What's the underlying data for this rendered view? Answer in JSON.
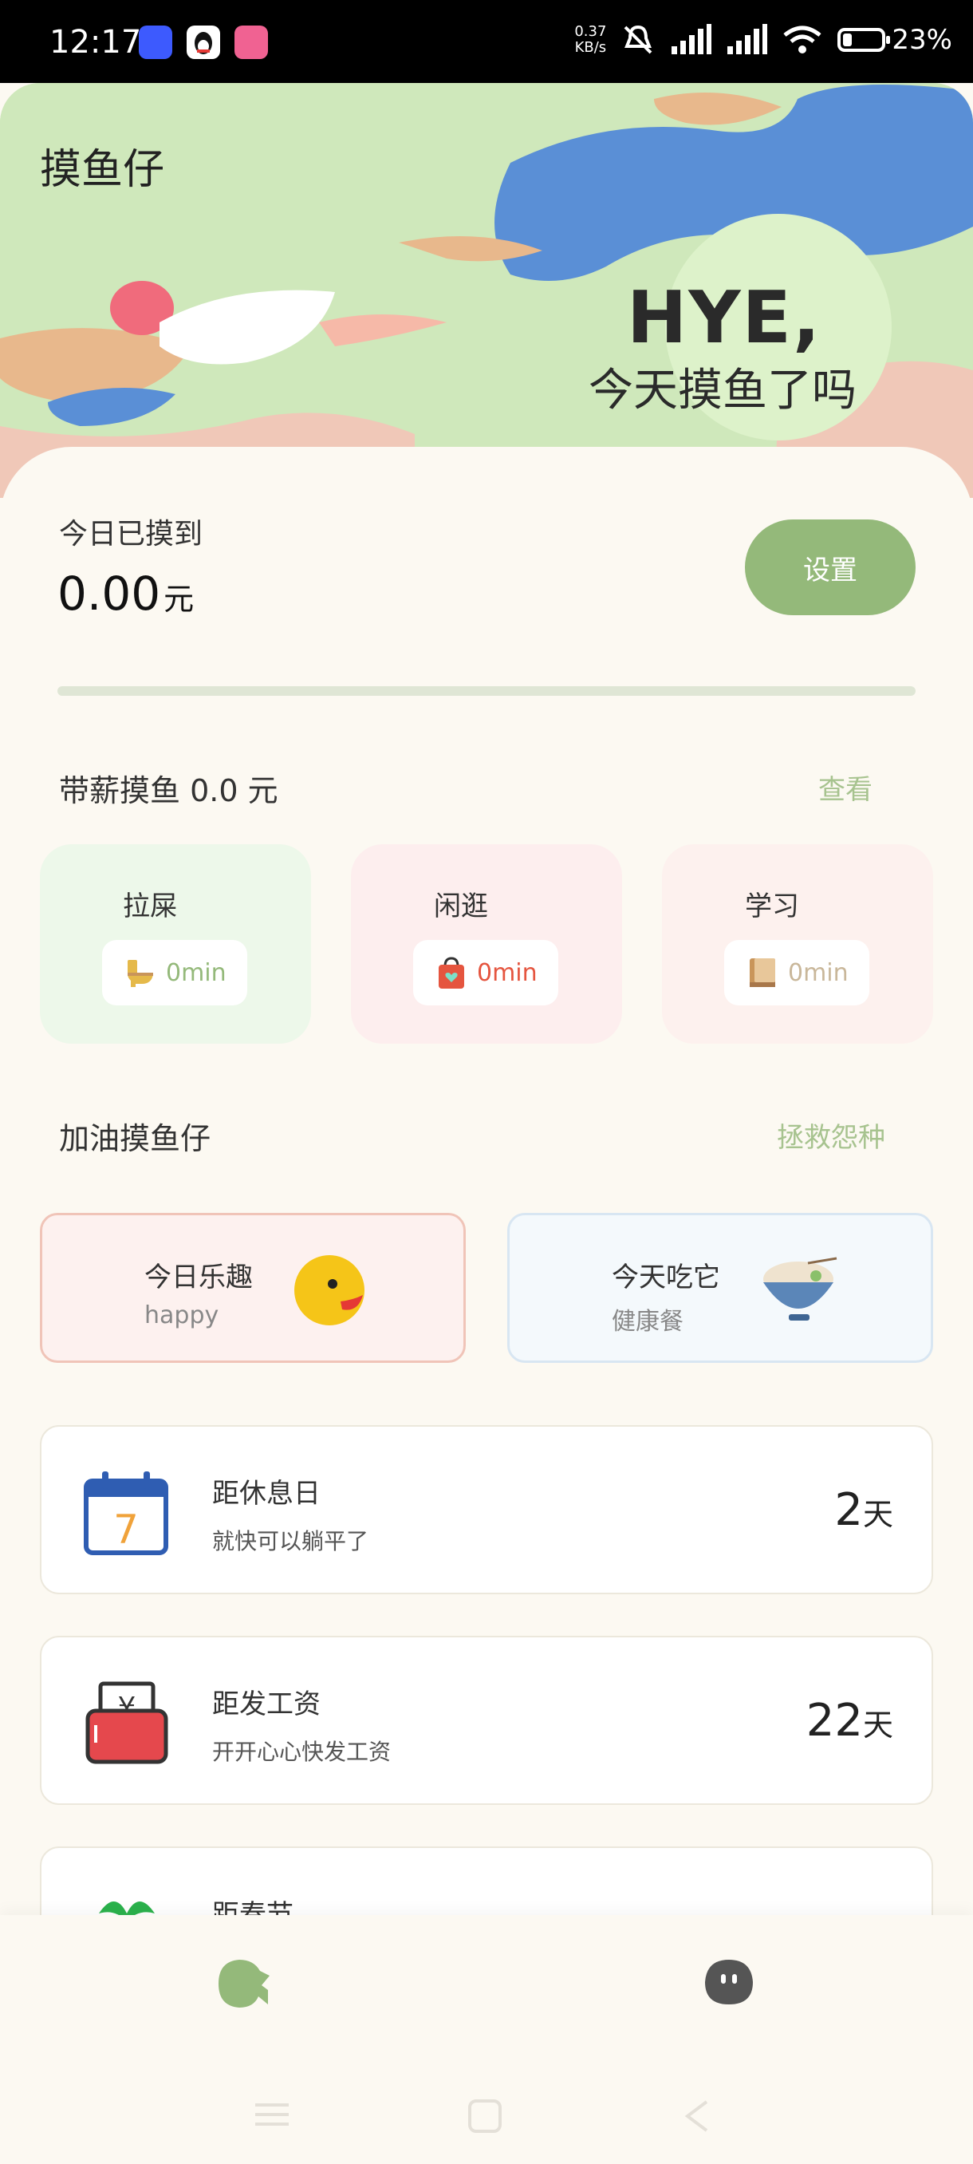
{
  "status_bar": {
    "time": "12:17",
    "net_speed_value": "0.37",
    "net_speed_unit": "KB/s",
    "battery_percent": "23%",
    "battery_level": 0.23
  },
  "header": {
    "app_title": "摸鱼仔",
    "hero_big": "HYE,",
    "hero_sub": "今天摸鱼了吗"
  },
  "earnings": {
    "label": "今日已摸到",
    "value": "0.00",
    "unit": "元",
    "settings_button": "设置",
    "progress": 0
  },
  "paid_slacking": {
    "title": "带薪摸鱼 0.0 元",
    "link": "查看",
    "activities": [
      {
        "label": "拉屎",
        "time": "0min",
        "icon": "toilet-icon",
        "bg": "#edf8ea",
        "color": "#94b97a"
      },
      {
        "label": "闲逛",
        "time": "0min",
        "icon": "shopping-bag-icon",
        "bg": "#fdeeee",
        "color": "#e5553f"
      },
      {
        "label": "学习",
        "time": "0min",
        "icon": "book-icon",
        "bg": "#fdf1ee",
        "color": "#c9955a"
      }
    ]
  },
  "cheer": {
    "title": "加油摸鱼仔",
    "link": "拯救怨种",
    "cards": [
      {
        "title": "今日乐趣",
        "subtitle": "happy",
        "icon": "smiley-icon"
      },
      {
        "title": "今天吃它",
        "subtitle": "健康餐",
        "icon": "noodle-bowl-icon"
      }
    ]
  },
  "countdowns": [
    {
      "title": "距休息日",
      "subtitle": "就快可以躺平了",
      "number": "2",
      "unit": "天",
      "icon": "calendar-icon"
    },
    {
      "title": "距发工资",
      "subtitle": "开开心心快发工资",
      "number": "22",
      "unit": "天",
      "icon": "wallet-icon"
    },
    {
      "title": "距春节",
      "subtitle": "",
      "number": "",
      "unit": "",
      "icon": "plant-icon"
    }
  ],
  "colors": {
    "accent": "#94b97a",
    "background": "#fcf9f2"
  }
}
